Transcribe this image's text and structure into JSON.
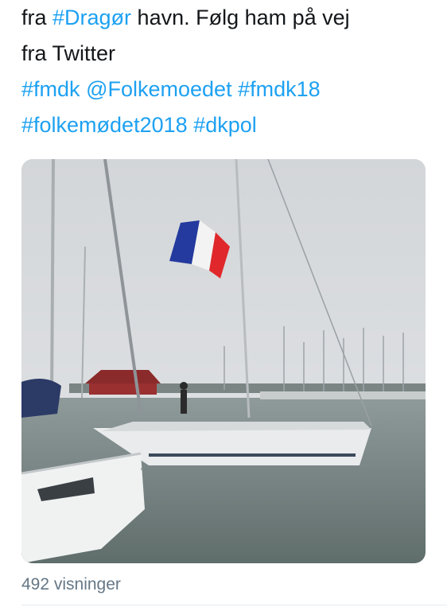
{
  "tweet": {
    "line1": {
      "text_before": "fra ",
      "hashtag": "#Dragør",
      "text_after": " havn. Følg ham på vej"
    },
    "line2": {
      "text": "fra Twitter"
    },
    "line3": {
      "tags": [
        "#fmdk",
        "@Folkemoedet",
        "#fmdk18"
      ]
    },
    "line4": {
      "tags": [
        "#folkemødet2018",
        "#dkpol"
      ]
    }
  },
  "media": {
    "type": "video",
    "description_icon": "video-thumbnail"
  },
  "stats": {
    "views": "492 visninger"
  },
  "colors": {
    "link": "#1da1f2",
    "text": "#14171a",
    "muted": "#657786"
  }
}
